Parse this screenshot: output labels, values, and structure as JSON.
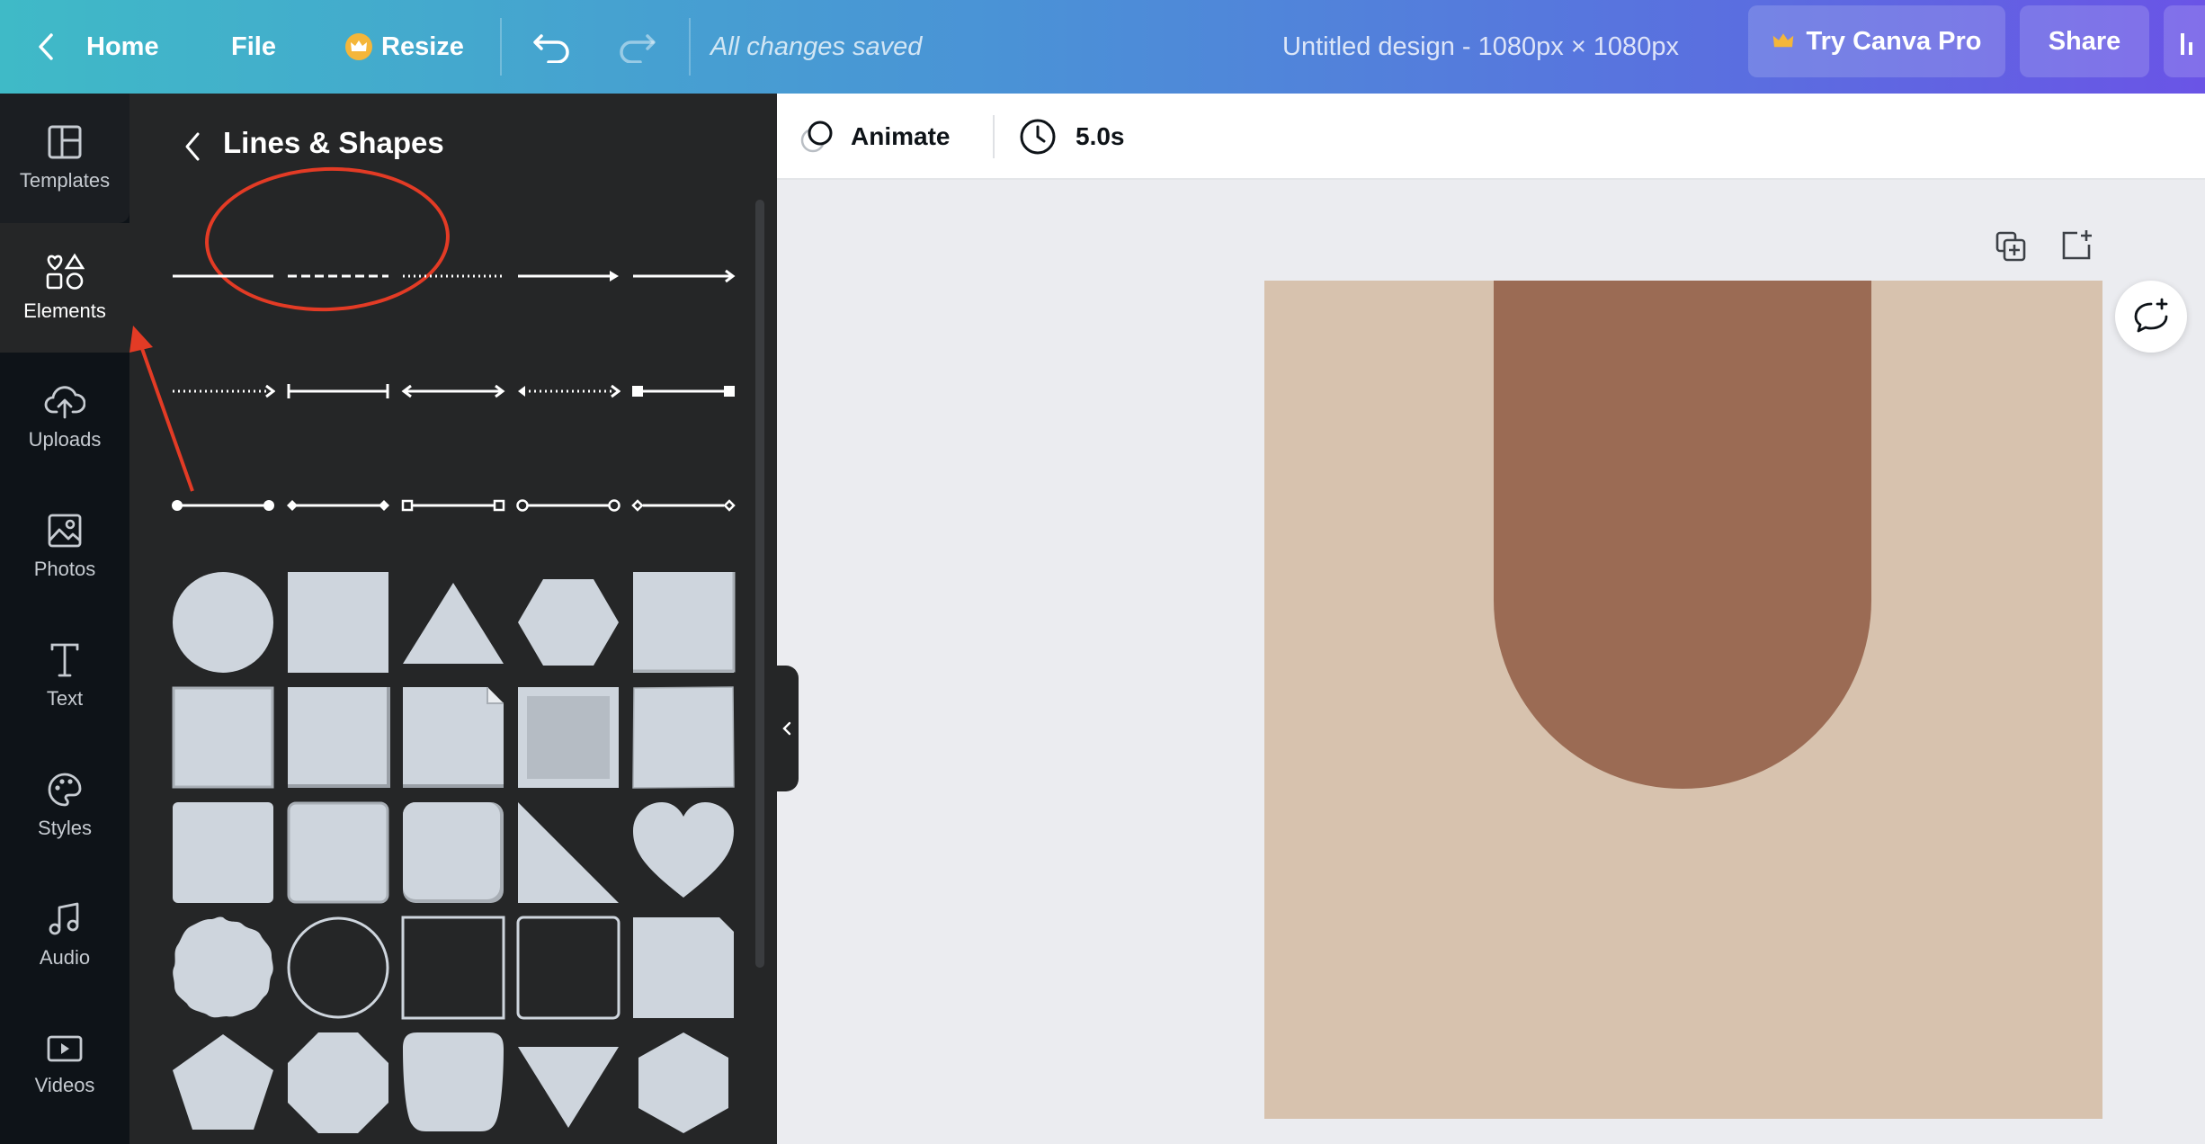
{
  "topbar": {
    "home_label": "Home",
    "file_label": "File",
    "resize_label": "Resize",
    "save_status": "All changes saved",
    "doc_title": "Untitled design - 1080px × 1080px",
    "try_pro_label": "Try Canva Pro",
    "share_label": "Share"
  },
  "rail": {
    "items": [
      {
        "label": "Templates",
        "icon": "templates-icon"
      },
      {
        "label": "Elements",
        "icon": "elements-icon"
      },
      {
        "label": "Uploads",
        "icon": "upload-cloud-icon"
      },
      {
        "label": "Photos",
        "icon": "photo-icon"
      },
      {
        "label": "Text",
        "icon": "text-icon"
      },
      {
        "label": "Styles",
        "icon": "palette-icon"
      },
      {
        "label": "Audio",
        "icon": "music-note-icon"
      },
      {
        "label": "Videos",
        "icon": "video-icon"
      }
    ],
    "active": "Elements"
  },
  "panel": {
    "title": "Lines & Shapes"
  },
  "subbar": {
    "animate_label": "Animate",
    "duration_label": "5.0s"
  },
  "colors": {
    "canvas_bg": "#d7c2ae",
    "arch_fill": "#9b6b54",
    "annotation": "#e33b25",
    "shape_fill": "#ced5dd",
    "panel_bg": "#252627"
  }
}
